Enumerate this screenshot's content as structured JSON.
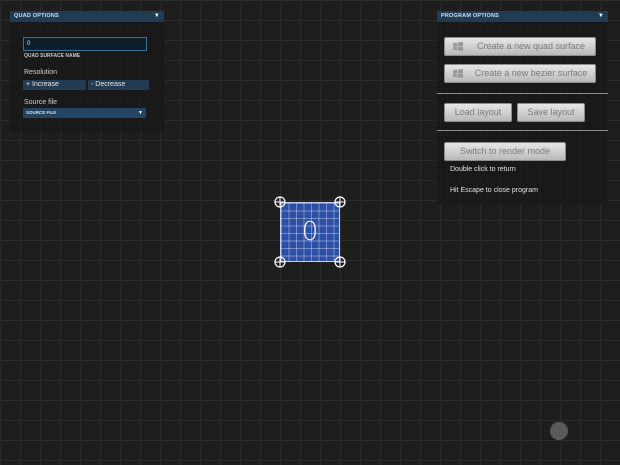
{
  "quad_panel": {
    "title": "QUAD OPTIONS",
    "name_value": "0",
    "name_label": "QUAD SURFACE NAME",
    "resolution_label": "Resolution",
    "increase_label": "+ Increase",
    "decrease_label": "- Decrease",
    "source_label": "Source file",
    "source_select": "SOURCE FILE"
  },
  "program_panel": {
    "title": "PROGRAM OPTIONS",
    "create_quad_label": "Create a new quad surface",
    "create_bezier_label": "Create a new bezier surface",
    "load_layout_label": "Load layout",
    "save_layout_label": "Save layout",
    "render_mode_label": "Switch to render mode",
    "double_click_text": "Double click to return",
    "escape_text": "Hit Escape to close program"
  },
  "surface": {
    "label": "0"
  },
  "colors": {
    "panel_header": "#213b55",
    "surface_fill": "#2d4fa6",
    "grid_line": "#2b2b2b",
    "background": "#1e1e1e"
  }
}
